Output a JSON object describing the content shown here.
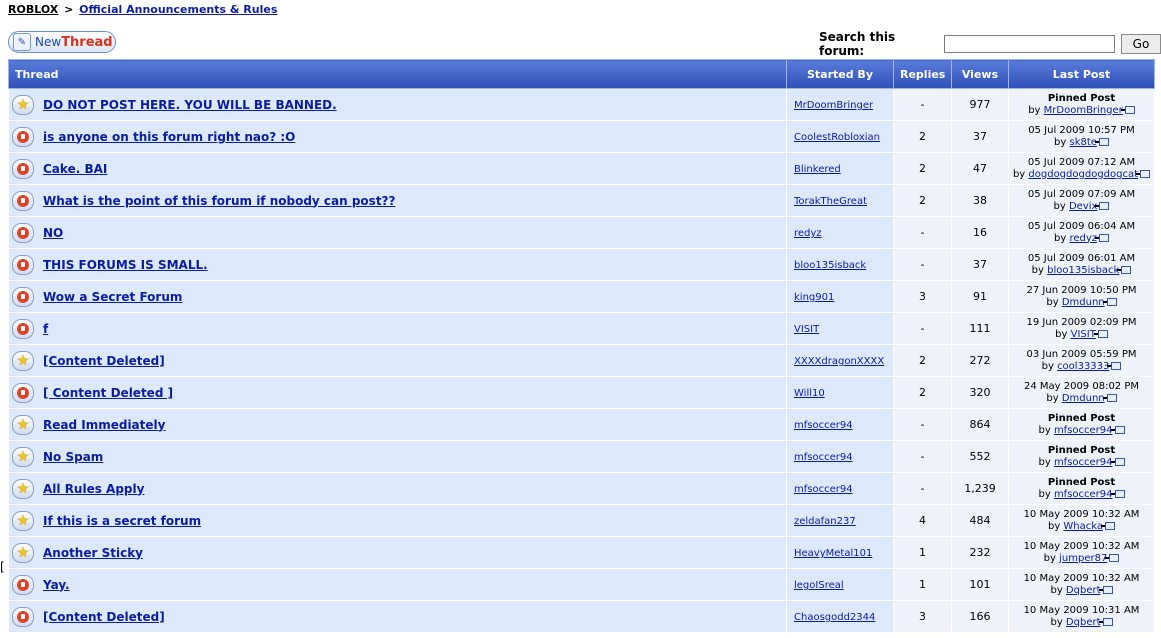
{
  "breadcrumb": {
    "root": "ROBLOX",
    "separator": ">",
    "forum": "Official Announcements & Rules"
  },
  "new_thread": {
    "new": "New",
    "thread": "Thread"
  },
  "search": {
    "label": "Search this forum:",
    "value": "",
    "go": "Go"
  },
  "columns": {
    "thread": "Thread",
    "started_by": "Started By",
    "replies": "Replies",
    "views": "Views",
    "last_post": "Last Post"
  },
  "edge_mark": "[",
  "threads": [
    {
      "icon": "star-icon",
      "title": "DO NOT POST HERE. YOU WILL BE BANNED.",
      "author": "MrDoomBringer",
      "replies": "-",
      "views": "977",
      "last_label": "Pinned Post",
      "last_by_prefix": "by",
      "last_by": "MrDoomBringer"
    },
    {
      "icon": "lock-icon",
      "title": "is anyone on this forum right nao? :O",
      "author": "CoolestRobloxian",
      "replies": "2",
      "views": "37",
      "last_label": "05 Jul 2009 10:57 PM",
      "last_by_prefix": "by",
      "last_by": "sk8te"
    },
    {
      "icon": "lock-icon",
      "title": "Cake. BAI",
      "author": "Blinkered",
      "replies": "2",
      "views": "47",
      "last_label": "05 Jul 2009 07:12 AM",
      "last_by_prefix": "by",
      "last_by": "dogdogdogdogdogcat"
    },
    {
      "icon": "lock-icon",
      "title": "What is the point of this forum if nobody can post??",
      "author": "TorakTheGreat",
      "replies": "2",
      "views": "38",
      "last_label": "05 Jul 2009 07:09 AM",
      "last_by_prefix": "by",
      "last_by": "Devix"
    },
    {
      "icon": "lock-icon",
      "title": "NO",
      "author": "redyz",
      "replies": "-",
      "views": "16",
      "last_label": "05 Jul 2009 06:04 AM",
      "last_by_prefix": "by",
      "last_by": "redyz"
    },
    {
      "icon": "lock-icon",
      "title": "THIS FORUMS IS SMALL.",
      "author": "bloo135isback",
      "replies": "-",
      "views": "37",
      "last_label": "05 Jul 2009 06:01 AM",
      "last_by_prefix": "by",
      "last_by": "bloo135isback"
    },
    {
      "icon": "lock-icon",
      "title": "Wow a Secret Forum",
      "author": "king901",
      "replies": "3",
      "views": "91",
      "last_label": "27 Jun 2009 10:50 PM",
      "last_by_prefix": "by",
      "last_by": "Dmdunn"
    },
    {
      "icon": "lock-icon",
      "title": "f",
      "author": "VISIT",
      "replies": "-",
      "views": "111",
      "last_label": "19 Jun 2009 02:09 PM",
      "last_by_prefix": "by",
      "last_by": "VISIT"
    },
    {
      "icon": "star-icon",
      "title": "[Content Deleted]",
      "author": "XXXXdragonXXXX",
      "replies": "2",
      "views": "272",
      "last_label": "03 Jun 2009 05:59 PM",
      "last_by_prefix": "by",
      "last_by": "cool33333"
    },
    {
      "icon": "lock-icon",
      "title": "[ Content Deleted ]",
      "author": "Will10",
      "replies": "2",
      "views": "320",
      "last_label": "24 May 2009 08:02 PM",
      "last_by_prefix": "by",
      "last_by": "Dmdunn"
    },
    {
      "icon": "star-icon",
      "title": "Read Immediately",
      "author": "mfsoccer94",
      "replies": "-",
      "views": "864",
      "last_label": "Pinned Post",
      "last_by_prefix": "by",
      "last_by": "mfsoccer94"
    },
    {
      "icon": "star-icon",
      "title": "No Spam",
      "author": "mfsoccer94",
      "replies": "-",
      "views": "552",
      "last_label": "Pinned Post",
      "last_by_prefix": "by",
      "last_by": "mfsoccer94"
    },
    {
      "icon": "star-icon",
      "title": "All Rules Apply",
      "author": "mfsoccer94",
      "replies": "-",
      "views": "1,239",
      "last_label": "Pinned Post",
      "last_by_prefix": "by",
      "last_by": "mfsoccer94"
    },
    {
      "icon": "star-icon",
      "title": "If this is a secret forum",
      "author": "zeldafan237",
      "replies": "4",
      "views": "484",
      "last_label": "10 May 2009 10:32 AM",
      "last_by_prefix": "by",
      "last_by": "Whacka"
    },
    {
      "icon": "star-icon",
      "title": "Another Sticky",
      "author": "HeavyMetal101",
      "replies": "1",
      "views": "232",
      "last_label": "10 May 2009 10:32 AM",
      "last_by_prefix": "by",
      "last_by": "jumper87"
    },
    {
      "icon": "lock-icon",
      "title": "Yay.",
      "author": "legoISreal",
      "replies": "1",
      "views": "101",
      "last_label": "10 May 2009 10:32 AM",
      "last_by_prefix": "by",
      "last_by": "Dqbert"
    },
    {
      "icon": "lock-icon",
      "title": "[Content Deleted]",
      "author": "Chaosgodd2344",
      "replies": "3",
      "views": "166",
      "last_label": "10 May 2009 10:31 AM",
      "last_by_prefix": "by",
      "last_by": "Dqbert"
    }
  ]
}
